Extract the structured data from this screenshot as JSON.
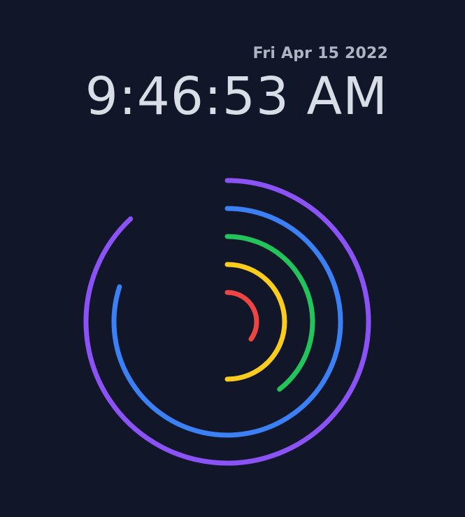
{
  "clock": {
    "date": "Fri Apr 15 2022",
    "time": "9:46:53 AM"
  },
  "rings": [
    {
      "unit": "year-month",
      "fraction": 0.88,
      "color": "#8b52f6"
    },
    {
      "unit": "day",
      "fraction": 0.8,
      "color": "#3b80f5"
    },
    {
      "unit": "hour",
      "fraction": 0.395,
      "color": "#23c45c"
    },
    {
      "unit": "minute",
      "fraction": 0.5,
      "color": "#f9cc1e"
    },
    {
      "unit": "second",
      "fraction": 0.35,
      "color": "#ef4444"
    }
  ]
}
